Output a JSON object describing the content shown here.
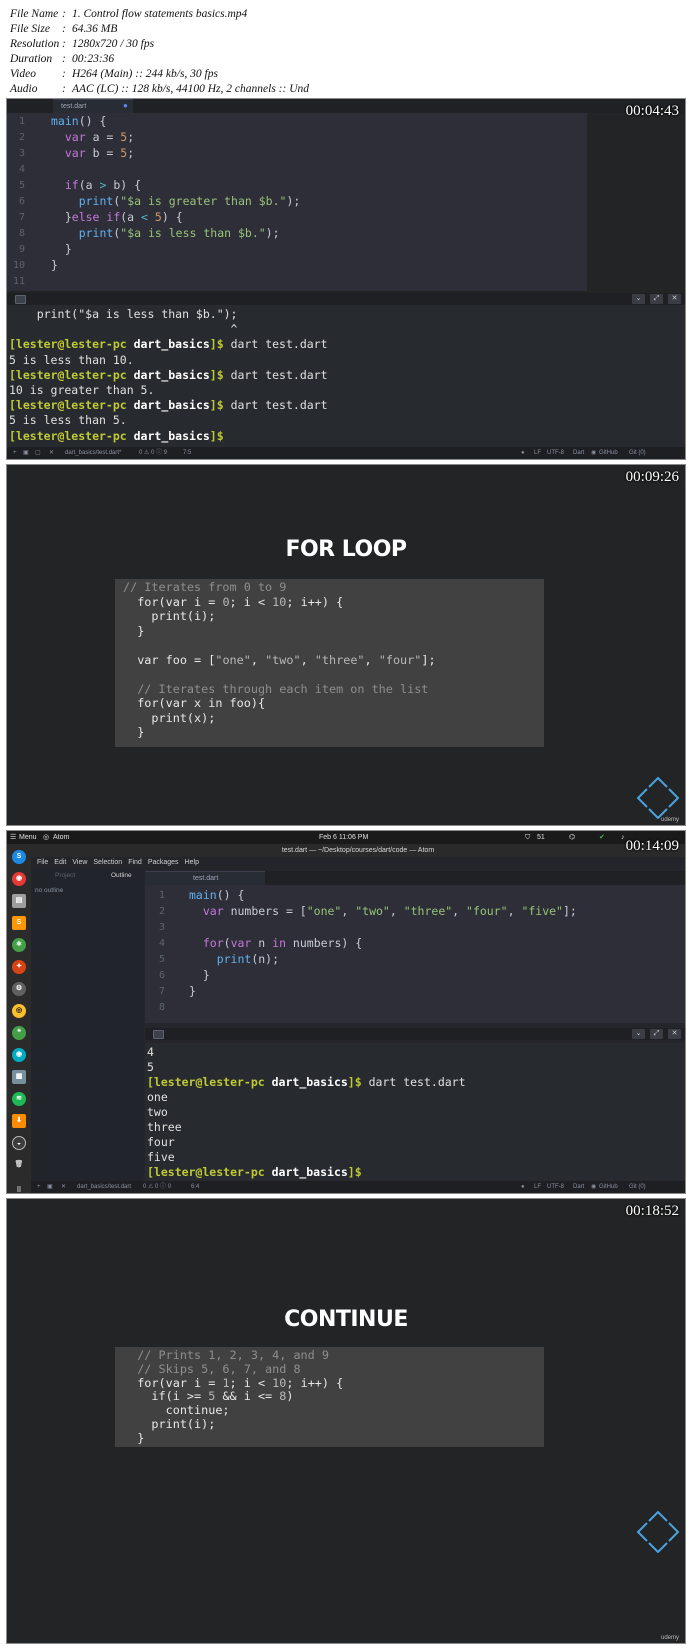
{
  "meta": [
    {
      "key": "File Name",
      "value": "1. Control flow statements basics.mp4"
    },
    {
      "key": "File Size",
      "value": "64.36 MB"
    },
    {
      "key": "Resolution",
      "value": "1280x720 / 30 fps"
    },
    {
      "key": "Duration",
      "value": "00:23:36"
    },
    {
      "key": "Video",
      "value": "H264 (Main) :: 244 kb/s, 30 fps"
    },
    {
      "key": "Audio",
      "value": "AAC (LC) :: 128 kb/s, 44100 Hz, 2 channels :: Und"
    }
  ],
  "frame1": {
    "timestamp": "00:04:43",
    "tab": "test.dart",
    "code": [
      {
        "n": "1",
        "parts": [
          [
            "fn",
            "main"
          ],
          [
            "",
            "() {"
          ]
        ]
      },
      {
        "n": "2",
        "parts": [
          [
            "",
            "  "
          ],
          [
            "kw",
            "var"
          ],
          [
            "",
            " a = "
          ],
          [
            "num",
            "5"
          ],
          [
            "",
            ";"
          ]
        ]
      },
      {
        "n": "3",
        "parts": [
          [
            "",
            "  "
          ],
          [
            "kw",
            "var"
          ],
          [
            "",
            " b = "
          ],
          [
            "num",
            "5"
          ],
          [
            "",
            ";"
          ]
        ]
      },
      {
        "n": "4",
        "parts": [
          [
            "",
            ""
          ]
        ]
      },
      {
        "n": "5",
        "parts": [
          [
            "",
            "  "
          ],
          [
            "kw",
            "if"
          ],
          [
            "",
            "(a "
          ],
          [
            "op",
            ">"
          ],
          [
            "",
            " b) {"
          ]
        ]
      },
      {
        "n": "6",
        "parts": [
          [
            "",
            "    "
          ],
          [
            "fn",
            "print"
          ],
          [
            "",
            "("
          ],
          [
            "str",
            "\"$a is greater than $b.\""
          ],
          [
            "",
            ");"
          ]
        ]
      },
      {
        "n": "7",
        "parts": [
          [
            "",
            "  }"
          ],
          [
            "kw",
            "else if"
          ],
          [
            "",
            "(a "
          ],
          [
            "op",
            "<"
          ],
          [
            "",
            " "
          ],
          [
            "num",
            "5"
          ],
          [
            "",
            ") {"
          ]
        ]
      },
      {
        "n": "8",
        "parts": [
          [
            "",
            "    "
          ],
          [
            "fn",
            "print"
          ],
          [
            "",
            "("
          ],
          [
            "str",
            "\"$a is less than $b.\""
          ],
          [
            "",
            ");"
          ]
        ]
      },
      {
        "n": "9",
        "parts": [
          [
            "",
            "  }"
          ]
        ]
      },
      {
        "n": "10",
        "parts": [
          [
            "",
            "}"
          ]
        ]
      },
      {
        "n": "11",
        "parts": [
          [
            "",
            ""
          ]
        ]
      }
    ],
    "terminal": [
      {
        "type": "text",
        "text": "    print(\"$a is less than $b.\");"
      },
      {
        "type": "text",
        "text": "                                ^"
      },
      {
        "type": "prompt",
        "user": "[lester@lester-pc",
        "dir": "dart_basics",
        "tail": "]$ dart test.dart"
      },
      {
        "type": "text",
        "text": "5 is less than 10."
      },
      {
        "type": "prompt",
        "user": "[lester@lester-pc",
        "dir": "dart_basics",
        "tail": "]$ dart test.dart"
      },
      {
        "type": "text",
        "text": "10 is greater than 5."
      },
      {
        "type": "prompt",
        "user": "[lester@lester-pc",
        "dir": "dart_basics",
        "tail": "]$ dart test.dart"
      },
      {
        "type": "text",
        "text": "5 is less than 5."
      },
      {
        "type": "prompt",
        "user": "[lester@lester-pc",
        "dir": "dart_basics",
        "tail": "]$"
      }
    ],
    "status": {
      "file": "dart_basics/test.dart*",
      "counts": "0 ⚠ 0 ⓘ 9",
      "pos": "7:5",
      "eol": "LF",
      "enc": "UTF-8",
      "lang": "Dart",
      "git": "GitHub",
      "extra": "Git (0)"
    }
  },
  "frame2": {
    "timestamp": "00:09:26",
    "title": "FOR LOOP",
    "code": [
      [
        [
          "cm",
          "// Iterates from 0 to 9"
        ]
      ],
      [
        [
          "",
          "  for(var i = "
        ],
        [
          "snum",
          "0"
        ],
        [
          "",
          "; i < "
        ],
        [
          "snum",
          "10"
        ],
        [
          "",
          "; i++) {"
        ]
      ],
      [
        [
          "",
          "    print(i);"
        ]
      ],
      [
        [
          "",
          "  }"
        ]
      ],
      [
        [
          "",
          ""
        ]
      ],
      [
        [
          "",
          "  var foo = ["
        ],
        [
          "sstr",
          "\"one\""
        ],
        [
          "",
          ", "
        ],
        [
          "sstr",
          "\"two\""
        ],
        [
          "",
          ", "
        ],
        [
          "sstr",
          "\"three\""
        ],
        [
          "",
          ", "
        ],
        [
          "sstr",
          "\"four\""
        ],
        [
          "",
          "];"
        ]
      ],
      [
        [
          "",
          ""
        ]
      ],
      [
        [
          "cm",
          "  // Iterates through each item on the list"
        ]
      ],
      [
        [
          "",
          "  for(var x in foo){"
        ]
      ],
      [
        [
          "",
          "    print(x);"
        ]
      ],
      [
        [
          "",
          "  }"
        ]
      ]
    ]
  },
  "frame3": {
    "timestamp": "00:14:09",
    "topbar": {
      "menu": "Menu",
      "app": "Atom",
      "clock": "Feb 6  11:06 PM",
      "battery": "51"
    },
    "window_title": "test.dart — ~/Desktop/courses/dart/code — Atom",
    "menus": [
      "File",
      "Edit",
      "View",
      "Selection",
      "Find",
      "Packages",
      "Help"
    ],
    "side": {
      "tab1": "Project",
      "tab2": "Outline",
      "empty": "no outline"
    },
    "tab": "test.dart",
    "code": [
      {
        "n": "1",
        "parts": [
          [
            "fn",
            "main"
          ],
          [
            "",
            "() {"
          ]
        ]
      },
      {
        "n": "2",
        "parts": [
          [
            "",
            "  "
          ],
          [
            "kw",
            "var"
          ],
          [
            "",
            " numbers = ["
          ],
          [
            "str",
            "\"one\""
          ],
          [
            "",
            ", "
          ],
          [
            "str",
            "\"two\""
          ],
          [
            "",
            ", "
          ],
          [
            "str",
            "\"three\""
          ],
          [
            "",
            ", "
          ],
          [
            "str",
            "\"four\""
          ],
          [
            "",
            ", "
          ],
          [
            "str",
            "\"five\""
          ],
          [
            "",
            "];"
          ]
        ]
      },
      {
        "n": "3",
        "parts": [
          [
            "",
            ""
          ]
        ]
      },
      {
        "n": "4",
        "parts": [
          [
            "",
            "  "
          ],
          [
            "kw",
            "for"
          ],
          [
            "",
            "("
          ],
          [
            "kw",
            "var"
          ],
          [
            "",
            " n "
          ],
          [
            "kw",
            "in"
          ],
          [
            "",
            " numbers) {"
          ]
        ]
      },
      {
        "n": "5",
        "parts": [
          [
            "",
            "    "
          ],
          [
            "fn",
            "print"
          ],
          [
            "",
            "(n);"
          ]
        ]
      },
      {
        "n": "6",
        "parts": [
          [
            "",
            "  }"
          ]
        ]
      },
      {
        "n": "7",
        "parts": [
          [
            "",
            "}"
          ]
        ]
      },
      {
        "n": "8",
        "parts": [
          [
            "",
            ""
          ]
        ]
      }
    ],
    "terminal": [
      {
        "type": "text",
        "text": "4"
      },
      {
        "type": "text",
        "text": "5"
      },
      {
        "type": "prompt",
        "user": "[lester@lester-pc",
        "dir": "dart_basics",
        "tail": "]$ dart test.dart"
      },
      {
        "type": "text",
        "text": "one"
      },
      {
        "type": "text",
        "text": "two"
      },
      {
        "type": "text",
        "text": "three"
      },
      {
        "type": "text",
        "text": "four"
      },
      {
        "type": "text",
        "text": "five"
      },
      {
        "type": "prompt",
        "user": "[lester@lester-pc",
        "dir": "dart_basics",
        "tail": "]$"
      }
    ],
    "status": {
      "file": "dart_basics/test.dart",
      "counts": "0 ⚠ 0 ⓘ 0",
      "pos": "6:4",
      "eol": "LF",
      "enc": "UTF-8",
      "lang": "Dart",
      "git": "GitHub",
      "extra": "Git (0)"
    }
  },
  "frame4": {
    "timestamp": "00:18:52",
    "title": "CONTINUE",
    "code": [
      [
        [
          "cm",
          "  // Prints 1, 2, 3, 4, and 9"
        ]
      ],
      [
        [
          "cm",
          "  // Skips 5, 6, 7, and 8"
        ]
      ],
      [
        [
          "",
          "  for(var i = "
        ],
        [
          "snum",
          "1"
        ],
        [
          "",
          "; i < "
        ],
        [
          "snum",
          "10"
        ],
        [
          "",
          "; i++) {"
        ]
      ],
      [
        [
          "",
          "    if(i >= "
        ],
        [
          "snum",
          "5"
        ],
        [
          "",
          " && i <= "
        ],
        [
          "snum",
          "8"
        ],
        [
          "",
          ")"
        ]
      ],
      [
        [
          "",
          "      continue;"
        ]
      ],
      [
        [
          "",
          "    print(i);"
        ]
      ],
      [
        [
          "",
          "  }"
        ]
      ]
    ]
  },
  "brand": "udemy"
}
